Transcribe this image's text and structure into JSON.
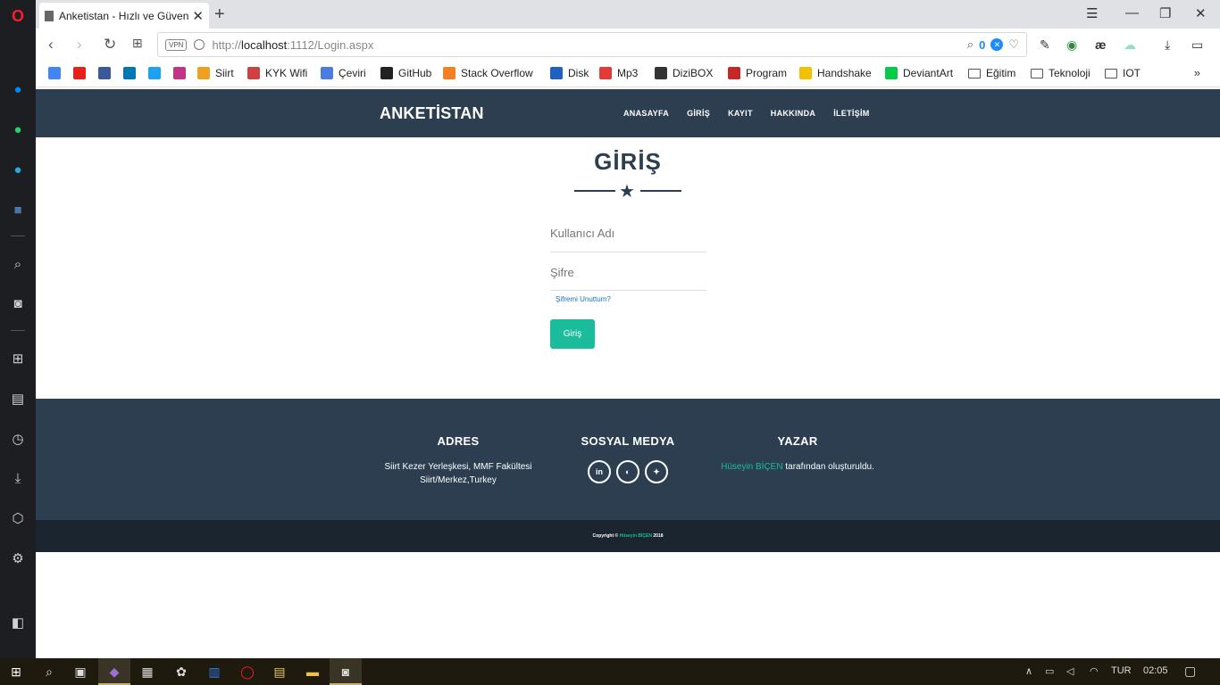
{
  "browser": {
    "tab_title": "Anketistan - Hızlı ve Güvenli Anket",
    "url_prefix": "http://",
    "url_host": "localhost",
    "url_path": ":1112/Login.aspx",
    "vpn_label": "VPN",
    "badge_count": "0",
    "bookmarks": [
      {
        "label": "",
        "color": "#4285f4"
      },
      {
        "label": "",
        "color": "#e62117"
      },
      {
        "label": "",
        "color": "#3b5998"
      },
      {
        "label": "",
        "color": "#0077b5"
      },
      {
        "label": "",
        "color": "#1da1f2"
      },
      {
        "label": "",
        "color": "#c13584"
      },
      {
        "label": "Siirt",
        "color": "#f0a020"
      },
      {
        "label": "KYK Wifi",
        "color": "#d04040"
      },
      {
        "label": "Çeviri",
        "color": "#4a7de0"
      },
      {
        "label": "GitHub",
        "color": "#222222"
      },
      {
        "label": "Stack Overflow",
        "color": "#f48024"
      },
      {
        "label": "Disk",
        "color": "#2060c0"
      },
      {
        "label": "Mp3",
        "color": "#e53935"
      },
      {
        "label": "DiziBOX",
        "color": "#333333"
      },
      {
        "label": "Program",
        "color": "#c62828"
      },
      {
        "label": "Handshake",
        "color": "#f2c200"
      },
      {
        "label": "DeviantArt",
        "color": "#05cc47"
      }
    ],
    "folders": [
      "Eğitim",
      "Teknoloji",
      "IOT"
    ]
  },
  "site": {
    "brand": "ANKETİSTAN",
    "nav": [
      "ANASAYFA",
      "GİRİŞ",
      "KAYIT",
      "HAKKINDA",
      "İLETİŞİM"
    ],
    "login": {
      "title": "GİRİŞ",
      "username_placeholder": "Kullanıcı Adı",
      "password_placeholder": "Şifre",
      "forgot": "Şifremi Unuttum?",
      "submit": "Giriş"
    },
    "footer": {
      "address_title": "ADRES",
      "address_line1": "Siirt Kezer Yerleşkesi, MMF Fakültesi",
      "address_line2": "Siirt/Merkez,Turkey",
      "social_title": "SOSYAL MEDYA",
      "social": [
        "in",
        "gh",
        "tw"
      ],
      "author_title": "YAZAR",
      "author_name": "Hüseyin BİÇEN",
      "author_suffix": " tarafından oluşturuldu.",
      "copyright_prefix": "Copyright © ",
      "copyright_name": "Hüseyin BİÇEN",
      "copyright_year": " 2018"
    },
    "colors": {
      "navbar": "#2c3e50",
      "accent": "#1abc9c",
      "copyright_bg": "#1a252f"
    }
  },
  "taskbar": {
    "language": "TUR",
    "time": "02:05"
  }
}
